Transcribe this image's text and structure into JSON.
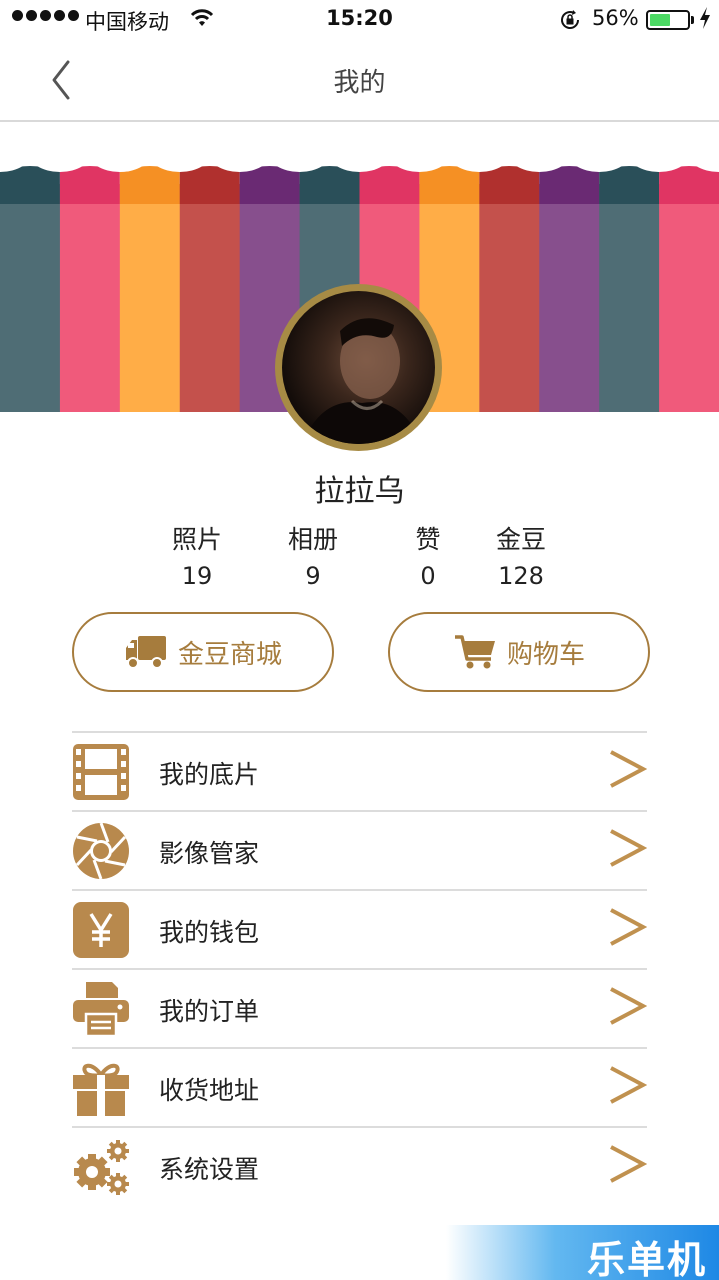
{
  "status_bar": {
    "carrier": "中国移动",
    "time": "15:20",
    "battery_percent": "56%",
    "battery_level": 0.56
  },
  "nav": {
    "title": "我的",
    "back_icon": "chevron-left-icon"
  },
  "banner": {
    "stripe_colors": [
      "#4f6d75",
      "#f05a7b",
      "#ffad47",
      "#c4514c",
      "#874f8d",
      "#4f6d75",
      "#f05a7b",
      "#ffad47",
      "#c4514c",
      "#874f8d",
      "#4f6d75",
      "#f05a7b"
    ],
    "valance_colors": [
      "#2a4f59",
      "#e03563",
      "#f59024",
      "#b0302e",
      "#6a2a73",
      "#2a4f59",
      "#e03563",
      "#f59024",
      "#b0302e",
      "#6a2a73",
      "#2a4f59",
      "#e03563"
    ]
  },
  "profile": {
    "username": "拉拉乌"
  },
  "stats": [
    {
      "label": "照片",
      "value": "19"
    },
    {
      "label": "相册",
      "value": "9"
    },
    {
      "label": "赞",
      "value": "0"
    },
    {
      "label": "金豆",
      "value": "128"
    }
  ],
  "actions": {
    "gold_mall": {
      "label": "金豆商城",
      "icon": "truck-icon"
    },
    "cart": {
      "label": "购物车",
      "icon": "cart-icon"
    }
  },
  "menu": [
    {
      "label": "我的底片",
      "icon": "film-icon"
    },
    {
      "label": "影像管家",
      "icon": "aperture-icon"
    },
    {
      "label": "我的钱包",
      "icon": "yen-icon"
    },
    {
      "label": "我的订单",
      "icon": "printer-icon"
    },
    {
      "label": "收货地址",
      "icon": "gift-icon"
    },
    {
      "label": "系统设置",
      "icon": "gears-icon"
    }
  ],
  "watermark": "乐单机",
  "colors": {
    "accent": "#a67c3d",
    "icon_gold": "#b8894d",
    "divider": "#dcdcdc"
  }
}
